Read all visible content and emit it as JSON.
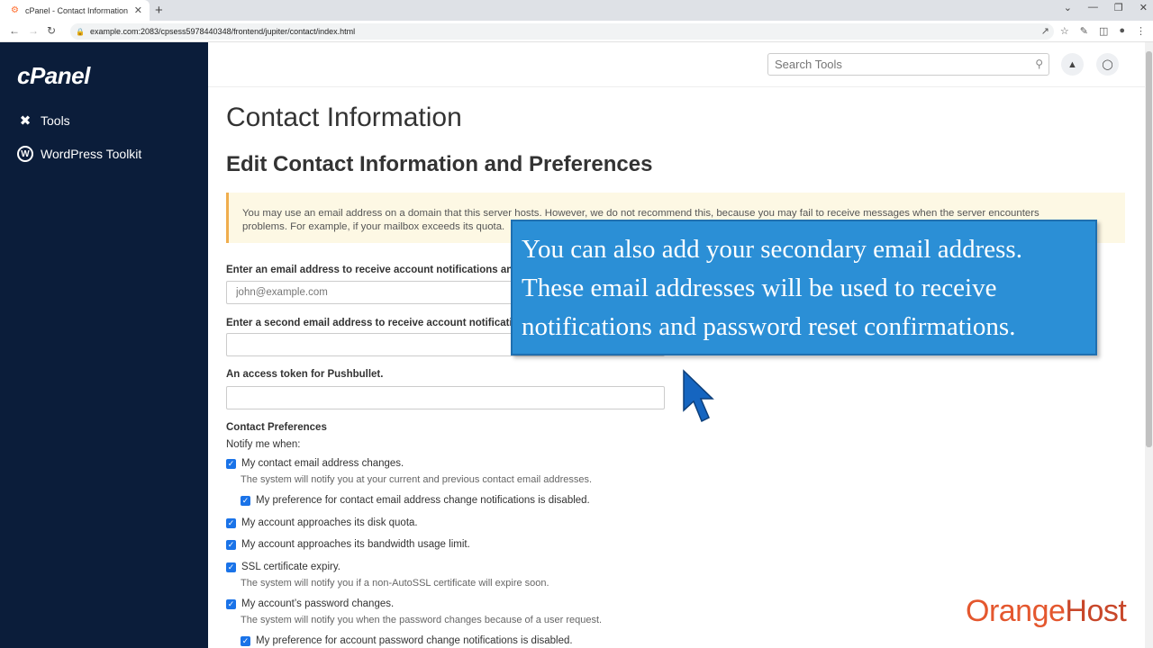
{
  "browser": {
    "tab_title": "cPanel - Contact Information",
    "url": "example.com:2083/cpsess5978440348/frontend/jupiter/contact/index.html"
  },
  "sidebar": {
    "logo": "cPanel",
    "items": [
      {
        "label": "Tools",
        "icon": "tools-icon"
      },
      {
        "label": "WordPress Toolkit",
        "icon": "wordpress-icon"
      }
    ]
  },
  "header": {
    "search_placeholder": "Search Tools"
  },
  "main": {
    "page_title": "Contact Information",
    "section_title": "Edit Contact Information and Preferences",
    "warning_line1": "You may use an email address on a domain that this server hosts. However, we do not recommend this, because you may fail to receive messages when the server encounters",
    "warning_line2": "problems. For example, if your mailbox exceeds its quota.",
    "email_label": "Enter an email address to receive account notifications an",
    "email_placeholder": "john@example.com",
    "email2_label": "Enter a second email address to receive account notificati",
    "pushbullet_label": "An access token for Pushbullet.",
    "prefs_title": "Contact Preferences",
    "notify_label": "Notify me when:",
    "checks": [
      {
        "label": "My contact email address changes.",
        "hint": "The system will notify you at your current and previous contact email addresses."
      },
      {
        "label": "My preference for contact email address change notifications is disabled."
      },
      {
        "label": "My account approaches its disk quota."
      },
      {
        "label": "My account approaches its bandwidth usage limit."
      },
      {
        "label": "SSL certificate expiry.",
        "hint": "The system will notify you if a non-AutoSSL certificate will expire soon."
      },
      {
        "label": "My account’s password changes.",
        "hint": "The system will notify you when the password changes because of a user request."
      },
      {
        "label": "My preference for account password change notifications is disabled."
      }
    ]
  },
  "callout": {
    "line1": "You can also add your secondary email address.",
    "line2": "These email addresses will be used to receive",
    "line3": "notifications and password reset confirmations."
  },
  "watermark": {
    "brand_a": "Orange",
    "brand_b": "Host"
  },
  "colors": {
    "sidebar_bg": "#0b1d3a",
    "checkbox": "#1a73e8",
    "callout_bg": "#2b8fd6",
    "watermark": "#e4572e"
  }
}
